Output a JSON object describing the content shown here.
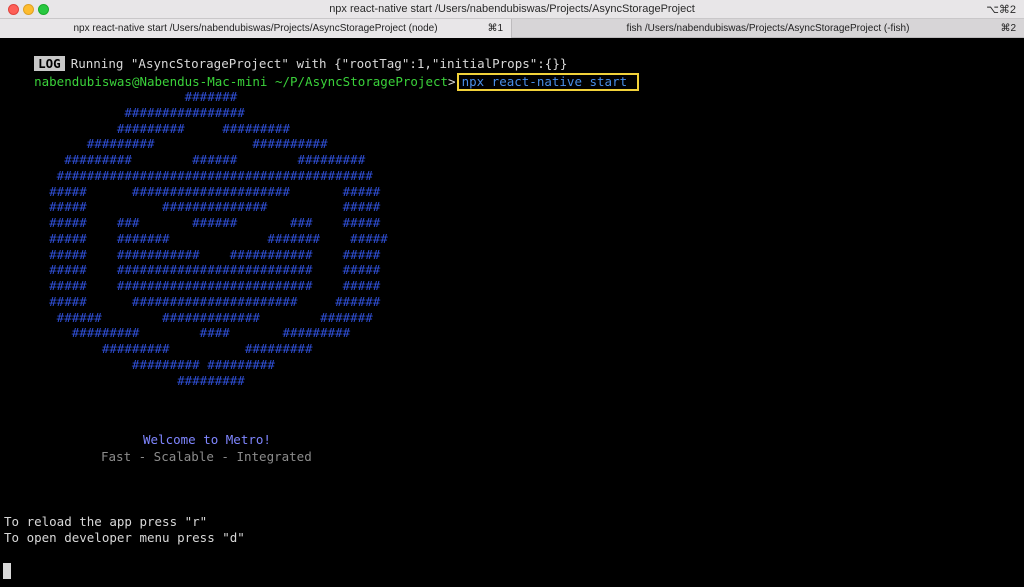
{
  "window": {
    "title": "npx react-native start /Users/nabendubiswas/Projects/AsyncStorageProject",
    "shortcut": "⌥⌘2"
  },
  "tabs": [
    {
      "label": "npx react-native start /Users/nabendubiswas/Projects/AsyncStorageProject (node)",
      "shortcut": "⌘1"
    },
    {
      "label": "fish /Users/nabendubiswas/Projects/AsyncStorageProject (-fish)",
      "shortcut": "⌘2"
    }
  ],
  "terminal": {
    "log_badge": "LOG",
    "log_text": "Running \"AsyncStorageProject\" with {\"rootTag\":1,\"initialProps\":{}}",
    "prompt_user": "nabendubiswas@Nabendus-Mac-mini",
    "prompt_cwd": "~/P/AsyncStorageProject",
    "prompt_symbol": ">",
    "command": "npx react-native start",
    "ascii_art": "                        #######\n                ################\n               #########     #########\n           #########             ##########\n        #########        ######        #########\n       ##########################################\n      #####      #####################       #####\n      #####          ##############          #####\n      #####    ###       ######       ###    #####\n      #####    #######             #######    #####\n      #####    ###########    ###########    #####\n      #####    ##########################    #####\n      #####    ##########################    #####\n      #####      ######################     ######\n       ######        #############        #######\n         #########        ####       #########\n             #########          #########\n                 ######### #########\n                       #########",
    "welcome": "Welcome to Metro!",
    "tagline": "Fast - Scalable - Integrated",
    "reload_hint": "To reload the app press \"r\"",
    "devmenu_hint": "To open developer menu press \"d\""
  }
}
